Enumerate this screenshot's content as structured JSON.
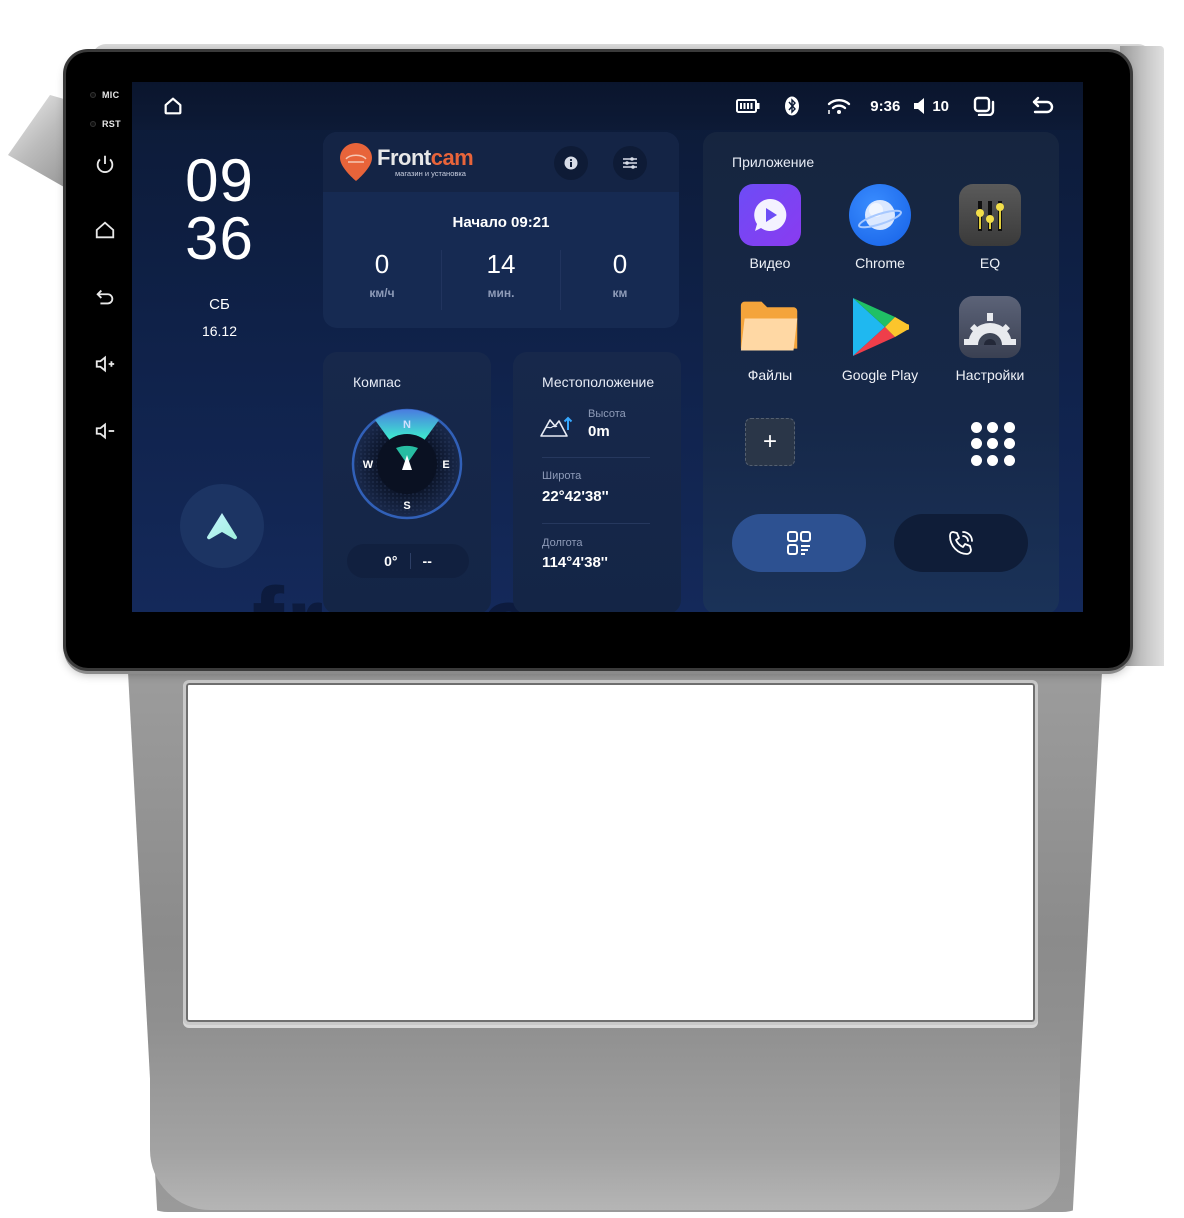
{
  "device": {
    "hardware_buttons": [
      {
        "name": "mic",
        "label": "MIC"
      },
      {
        "name": "rst",
        "label": "RST"
      },
      {
        "name": "power",
        "icon": "power-icon"
      },
      {
        "name": "home",
        "icon": "home-icon"
      },
      {
        "name": "back",
        "icon": "back-icon"
      },
      {
        "name": "volume-up",
        "icon": "volume-up-icon"
      },
      {
        "name": "volume-down",
        "icon": "volume-down-icon"
      }
    ]
  },
  "statusbar": {
    "home_icon": "home-icon",
    "battery_icon": "battery-icon",
    "bluetooth_icon": "bluetooth-icon",
    "wifi_icon": "wifi-icon",
    "time": "9:36",
    "volume_icon": "volume-icon",
    "volume_level": "10",
    "recent_apps_icon": "recent-apps-icon",
    "back_icon": "back-icon"
  },
  "clock": {
    "hours": "09",
    "minutes": "36",
    "day": "СБ",
    "date": "16.12",
    "nav_icon": "navigation-arrow-icon"
  },
  "trip": {
    "brand_name_part1": "Front",
    "brand_name_part2": "cam",
    "brand_tagline": "магазин и установка",
    "info_icon": "info-icon",
    "settings_icon": "sliders-icon",
    "start_label": "Начало 09:21",
    "stats": [
      {
        "value": "0",
        "unit": "км/ч"
      },
      {
        "value": "14",
        "unit": "мин."
      },
      {
        "value": "0",
        "unit": "км"
      }
    ]
  },
  "compass": {
    "title": "Компас",
    "directions": {
      "n": "N",
      "e": "E",
      "s": "S",
      "w": "W"
    },
    "heading": "0°",
    "heading_dir": "--"
  },
  "location": {
    "title": "Местоположение",
    "altitude_label": "Высота",
    "altitude_value": "0m",
    "latitude_label": "Широта",
    "latitude_value": "22°42'38''",
    "longitude_label": "Долгота",
    "longitude_value": "114°4'38''"
  },
  "apps": {
    "title": "Приложение",
    "items": [
      {
        "label": "Видео",
        "icon": "video-app-icon"
      },
      {
        "label": "Chrome",
        "icon": "chrome-app-icon"
      },
      {
        "label": "EQ",
        "icon": "eq-app-icon"
      },
      {
        "label": "Файлы",
        "icon": "files-app-icon"
      },
      {
        "label": "Google Play",
        "icon": "google-play-app-icon"
      },
      {
        "label": "Настройки",
        "icon": "settings-app-icon"
      }
    ],
    "add_label": "+",
    "all_apps_icon": "all-apps-grid-icon",
    "apps_button_icon": "apps-qr-icon",
    "phone_button_icon": "phone-call-icon"
  },
  "watermark": "frontcam.ru",
  "colors": {
    "screen_bg": "#0f2148",
    "card_bg": "#162a52",
    "accent_blue": "#2d5191",
    "brand_orange": "#e8643a",
    "compass_teal": "#3fe3d0"
  }
}
